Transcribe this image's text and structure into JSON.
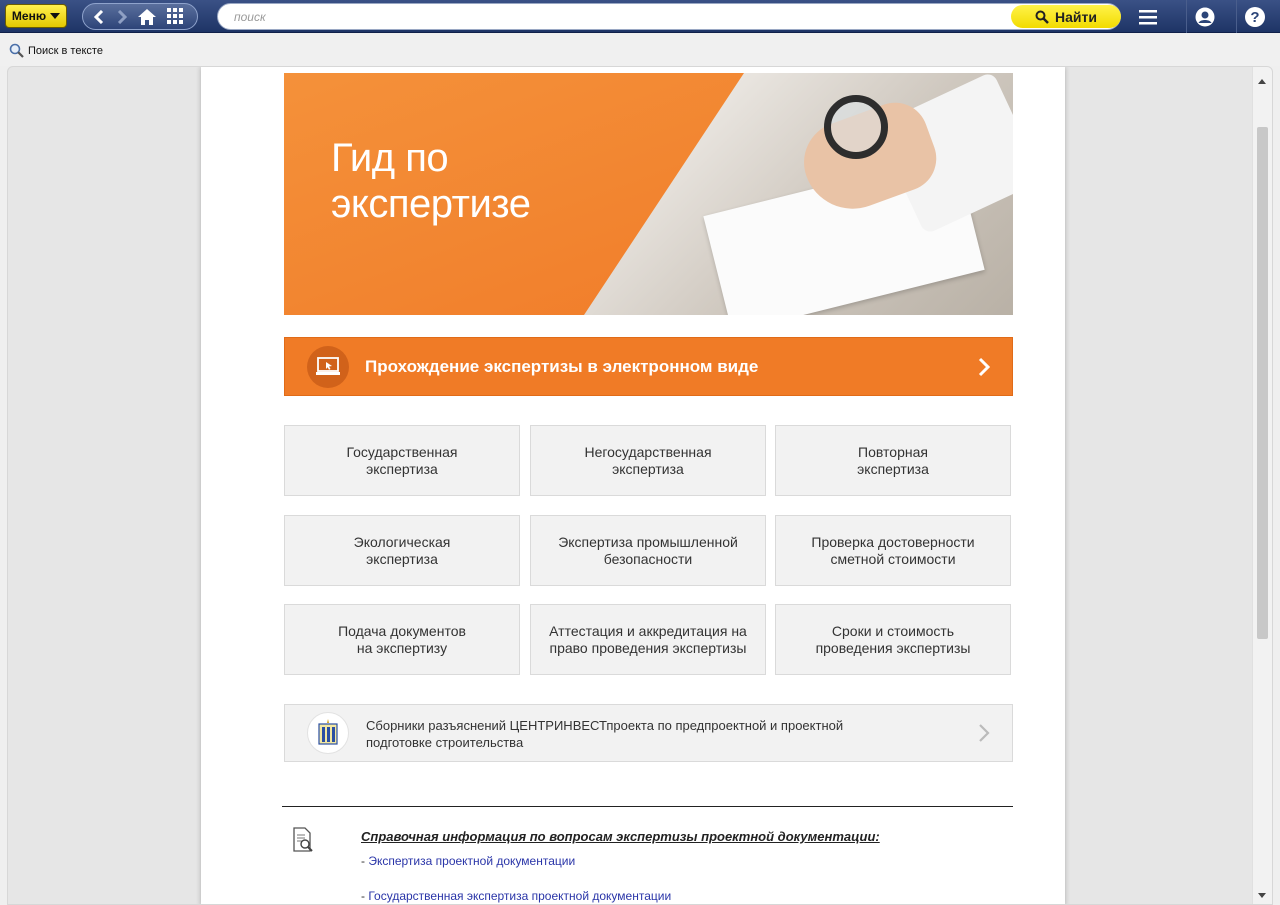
{
  "toolbar": {
    "menu_label": "Меню",
    "search_placeholder": "поиск",
    "find_label": "Найти"
  },
  "subbar": {
    "search_in_text": "Поиск в тексте"
  },
  "banner": {
    "title_line1": "Гид по",
    "title_line2": "экспертизе"
  },
  "electronic": {
    "label": "Прохождение экспертизы в электронном виде"
  },
  "tiles": [
    "Государственная\nэкспертиза",
    "Негосударственная\nэкспертиза",
    "Повторная\nэкспертиза",
    "Экологическая\nэкспертиза",
    "Экспертиза промышленной\nбезопасности",
    "Проверка достоверности\nсметной стоимости",
    "Подача документов\nна экспертизу",
    "Аттестация и аккредитация на\nправо проведения экспертизы",
    "Сроки и стоимость\nпроведения экспертизы"
  ],
  "collections": {
    "label": "Сборники разъяснений ЦЕНТРИНВЕСТпроекта по предпроектной и проектной подготовке строительства"
  },
  "reference": {
    "title": "Справочная информация по вопросам экспертизы проектной документации:",
    "links": [
      "Экспертиза проектной документации",
      "Государственная экспертиза проектной документации"
    ],
    "dash": "- "
  },
  "colors": {
    "accent_orange": "#f07b26",
    "topbar_blue": "#2a4073",
    "button_yellow": "#f5e200",
    "link_blue": "#2a35a8"
  }
}
